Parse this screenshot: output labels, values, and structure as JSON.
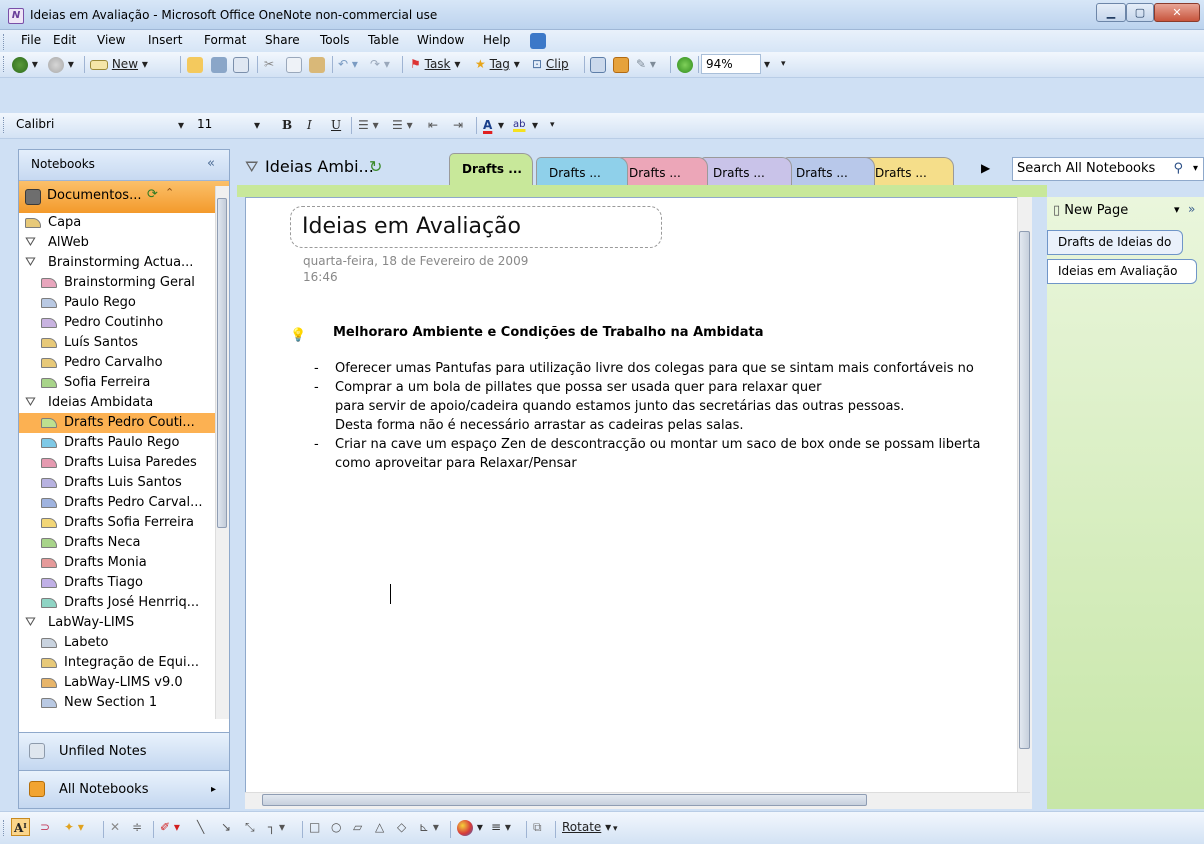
{
  "window": {
    "title": "Ideias em Avaliação - Microsoft Office OneNote non-commercial use",
    "app_icon": "onenote-icon",
    "controls": [
      "minimize",
      "maximize",
      "close"
    ]
  },
  "menubar": {
    "items": [
      {
        "label": "File",
        "key": "F"
      },
      {
        "label": "Edit",
        "key": "E"
      },
      {
        "label": "View",
        "key": "V"
      },
      {
        "label": "Insert",
        "key": "I"
      },
      {
        "label": "Format",
        "key": "o"
      },
      {
        "label": "Share",
        "key": "S"
      },
      {
        "label": "Tools",
        "key": "T"
      },
      {
        "label": "Table",
        "key": "b"
      },
      {
        "label": "Window",
        "key": "W"
      },
      {
        "label": "Help",
        "key": "H"
      }
    ]
  },
  "standard_toolbar": {
    "new_label": "New",
    "task_label": "Task",
    "tag_label": "Tag",
    "clip_label": "Clip",
    "zoom": "94%"
  },
  "formatting_toolbar": {
    "font": "Calibri",
    "size": "11",
    "bold": "B",
    "italic": "I",
    "underline": "U",
    "font_color_label": "A",
    "highlight_label": "ab"
  },
  "nav": {
    "header": "Notebooks",
    "collapse_glyph": "«",
    "current_notebook": "Documentos...",
    "tree": [
      {
        "label": "Capa",
        "kind": "section",
        "indent": 0,
        "color": "#e7c979"
      },
      {
        "label": "AlWeb",
        "kind": "group",
        "indent": 0
      },
      {
        "label": "Brainstorming Actua...",
        "kind": "group",
        "indent": 0
      },
      {
        "label": "Brainstorming Geral",
        "kind": "section",
        "indent": 1,
        "color": "#e8a6bd"
      },
      {
        "label": "Paulo Rego",
        "kind": "section",
        "indent": 1,
        "color": "#b9c9e3"
      },
      {
        "label": "Pedro Coutinho",
        "kind": "section",
        "indent": 1,
        "color": "#c8b3e0"
      },
      {
        "label": "Luís Santos",
        "kind": "section",
        "indent": 1,
        "color": "#e7c979"
      },
      {
        "label": "Pedro Carvalho",
        "kind": "section",
        "indent": 1,
        "color": "#e7c979"
      },
      {
        "label": "Sofia Ferreira",
        "kind": "section",
        "indent": 1,
        "color": "#a8d48a"
      },
      {
        "label": "Ideias Ambidata",
        "kind": "group",
        "indent": 0
      },
      {
        "label": "Drafts Pedro Couti...",
        "kind": "section",
        "indent": 1,
        "color": "#bde08f",
        "selected": true
      },
      {
        "label": "Drafts Paulo Rego",
        "kind": "section",
        "indent": 1,
        "color": "#7fc9e6"
      },
      {
        "label": "Drafts Luisa Paredes",
        "kind": "section",
        "indent": 1,
        "color": "#e59ab0"
      },
      {
        "label": "Drafts Luis Santos",
        "kind": "section",
        "indent": 1,
        "color": "#b7b2e0"
      },
      {
        "label": "Drafts Pedro Carval...",
        "kind": "section",
        "indent": 1,
        "color": "#9fb3df"
      },
      {
        "label": "Drafts Sofia Ferreira",
        "kind": "section",
        "indent": 1,
        "color": "#f2d677"
      },
      {
        "label": "Drafts Neca",
        "kind": "section",
        "indent": 1,
        "color": "#a8d48a"
      },
      {
        "label": "Drafts Monia",
        "kind": "section",
        "indent": 1,
        "color": "#e59a9a"
      },
      {
        "label": "Drafts Tiago",
        "kind": "section",
        "indent": 1,
        "color": "#c0b0e6"
      },
      {
        "label": "Drafts José Henrriq...",
        "kind": "section",
        "indent": 1,
        "color": "#8fd4c4"
      },
      {
        "label": "LabWay-LIMS",
        "kind": "group",
        "indent": 0
      },
      {
        "label": "Labeto",
        "kind": "section",
        "indent": 1,
        "color": "#c9d3df"
      },
      {
        "label": "Integração de Equi...",
        "kind": "section",
        "indent": 1,
        "color": "#e7c979"
      },
      {
        "label": "LabWay-LIMS v9.0",
        "kind": "section",
        "indent": 1,
        "color": "#e7b56a"
      },
      {
        "label": "New Section 1",
        "kind": "section",
        "indent": 1,
        "color": "#b9c9e3"
      }
    ],
    "unfiled_label": "Unfiled Notes",
    "all_notebooks_label": "All Notebooks"
  },
  "section_bar": {
    "group_title": "Ideias Ambi...",
    "tabs": [
      {
        "label": "Drafts ...",
        "color": "#c8e89a",
        "active": true
      },
      {
        "label": "Drafts ...",
        "color": "#8fd0ea"
      },
      {
        "label": "Drafts ...",
        "color": "#eca6b8"
      },
      {
        "label": "Drafts ...",
        "color": "#c9c3e9"
      },
      {
        "label": "Drafts ...",
        "color": "#b8c8ea"
      },
      {
        "label": "Drafts ...",
        "color": "#f5de8a"
      }
    ],
    "search_placeholder": "Search All Notebooks"
  },
  "page": {
    "title": "Ideias em Avaliação",
    "date": "quarta-feira, 18 de Fevereiro de 2009",
    "time": "16:46",
    "heading": "Melhoraro Ambiente e Condições de Trabalho na Ambidata",
    "lines": [
      {
        "dash": "-",
        "text": "Oferecer umas Pantufas  para utilização livre dos colegas para que se sintam mais confortáveis no"
      },
      {
        "dash": "-",
        "text": "Comprar a um bola de pillates que possa ser usada quer para relaxar quer"
      },
      {
        "dash": "",
        "text": "para servir de apoio/cadeira quando estamos junto das secretárias das outras pessoas."
      },
      {
        "dash": "",
        "text": "Desta forma não é necessário arrastar as cadeiras pelas salas."
      },
      {
        "dash": "-",
        "text": "Criar na cave um espaço Zen de descontracção ou montar um saco de box onde se possam liberta"
      },
      {
        "dash": "",
        "text": "como aproveitar para Relaxar/Pensar"
      }
    ]
  },
  "pagelist": {
    "new_page_label": "New Page",
    "pages": [
      {
        "label": "Drafts de Ideias do",
        "selected": false
      },
      {
        "label": "Ideias em Avaliação",
        "selected": true
      }
    ]
  },
  "drawing_toolbar": {
    "rotate_label": "Rotate"
  },
  "colors": {
    "window_chrome": "#cfe0f4",
    "selected_section": "#fcb152",
    "notebook_header": "#f39a2b",
    "page_list_bg": "#c7e6a8"
  }
}
